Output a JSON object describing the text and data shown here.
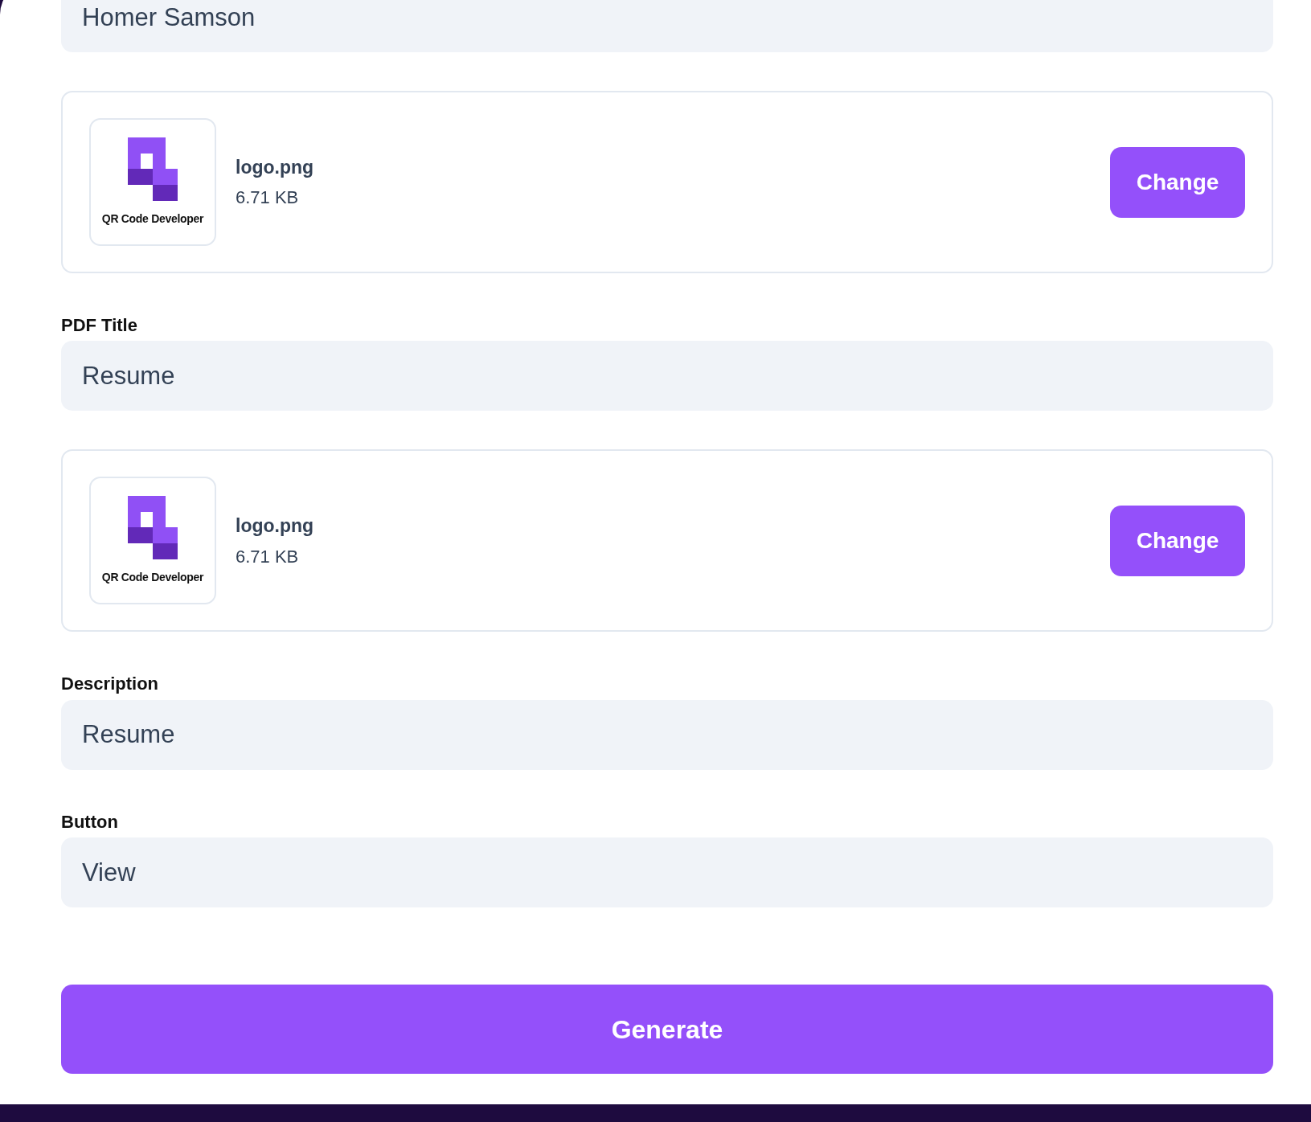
{
  "sections": [
    {
      "kind": "field",
      "value": "Homer Samson"
    },
    {
      "kind": "file",
      "logo_caption": "QR Code Developer",
      "file_name": "logo.png",
      "file_size": "6.71 KB",
      "button": "Change"
    },
    {
      "kind": "field",
      "label": "PDF Title",
      "value": "Resume"
    },
    {
      "kind": "file",
      "logo_caption": "QR Code Developer",
      "file_name": "logo.png",
      "file_size": "6.71 KB",
      "button": "Change"
    },
    {
      "kind": "field",
      "label": "Description",
      "value": "Resume"
    },
    {
      "kind": "field",
      "label": "Button",
      "value": "View"
    }
  ],
  "submit": "Generate"
}
